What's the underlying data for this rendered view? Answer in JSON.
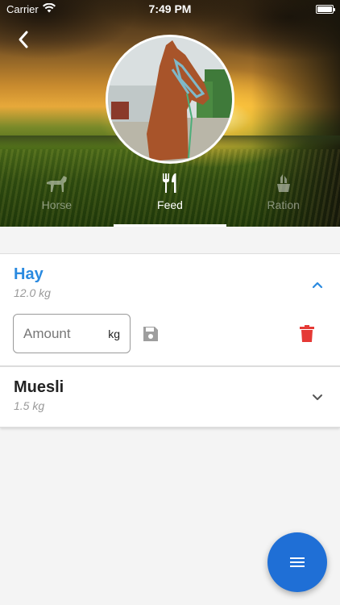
{
  "status_bar": {
    "carrier": "Carrier",
    "time": "7:49 PM"
  },
  "header": {
    "back_icon": "chevron-left-icon"
  },
  "tabs": [
    {
      "label": "Horse",
      "icon": "horse-icon",
      "active": false
    },
    {
      "label": "Feed",
      "icon": "fork-knife-icon",
      "active": true
    },
    {
      "label": "Ration",
      "icon": "ration-icon",
      "active": false
    }
  ],
  "feed_items": [
    {
      "name": "Hay",
      "amount": "12.0 kg",
      "expanded": true,
      "name_color": "#2a8ae0",
      "amount_field": {
        "placeholder": "Amount",
        "value": "",
        "unit": "kg"
      }
    },
    {
      "name": "Muesli",
      "amount": "1.5 kg",
      "expanded": false,
      "name_color": "#222222"
    }
  ],
  "colors": {
    "accent": "#2a8ae0",
    "fab": "#1f6fd6",
    "delete": "#e53935",
    "save": "#9e9e9e"
  },
  "fab": {
    "icon": "menu-icon"
  }
}
